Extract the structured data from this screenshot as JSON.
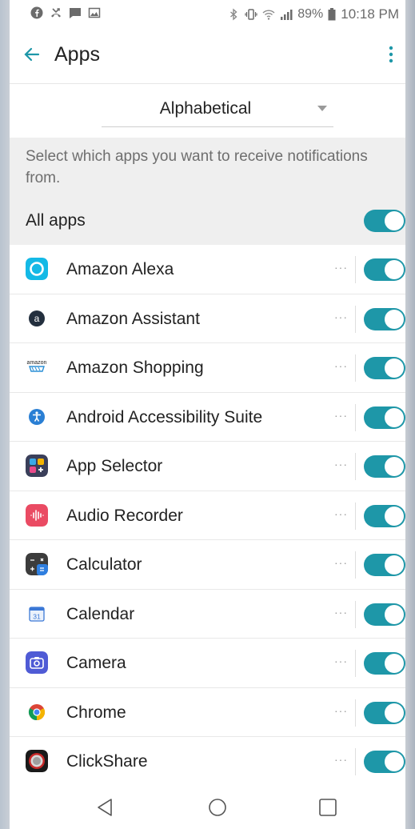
{
  "status_bar": {
    "left_icons": [
      "facebook-icon",
      "missed-call-icon",
      "message-icon",
      "image-icon"
    ],
    "right_icons": [
      "bluetooth-icon",
      "vibrate-icon",
      "wifi-icon",
      "signal-icon",
      "battery-icon"
    ],
    "battery": "89%",
    "time": "10:18 PM"
  },
  "app_bar": {
    "title": "Apps",
    "back_icon": "back-arrow-icon",
    "menu_icon": "overflow-menu-icon"
  },
  "sort": {
    "selected": "Alphabetical"
  },
  "description": "Select which apps you want to receive notifications from.",
  "all_apps": {
    "label": "All apps",
    "enabled": true
  },
  "apps": [
    {
      "name": "Amazon Alexa",
      "icon": "amazon-alexa-icon",
      "more": "···",
      "enabled": true
    },
    {
      "name": "Amazon Assistant",
      "icon": "amazon-assistant-icon",
      "more": "···",
      "enabled": true
    },
    {
      "name": "Amazon Shopping",
      "icon": "amazon-shopping-icon",
      "icon_text": "amazon",
      "more": "···",
      "enabled": true
    },
    {
      "name": "Android Accessibility Suite",
      "icon": "accessibility-icon",
      "more": "···",
      "enabled": true
    },
    {
      "name": "App Selector",
      "icon": "app-selector-icon",
      "more": "···",
      "enabled": true
    },
    {
      "name": "Audio Recorder",
      "icon": "audio-recorder-icon",
      "more": "···",
      "enabled": true
    },
    {
      "name": "Calculator",
      "icon": "calculator-icon",
      "more": "···",
      "enabled": true
    },
    {
      "name": "Calendar",
      "icon": "calendar-icon",
      "icon_text": "31",
      "more": "···",
      "enabled": true
    },
    {
      "name": "Camera",
      "icon": "camera-icon",
      "more": "···",
      "enabled": true
    },
    {
      "name": "Chrome",
      "icon": "chrome-icon",
      "more": "···",
      "enabled": true
    },
    {
      "name": "ClickShare",
      "icon": "clickshare-icon",
      "more": "···",
      "enabled": true
    }
  ],
  "nav_bar": {
    "icons": [
      "nav-back-icon",
      "nav-home-icon",
      "nav-recents-icon"
    ]
  },
  "colors": {
    "accent": "#1e97a8",
    "toggle_on": "#1e97a8",
    "section_bg": "#efefef"
  }
}
